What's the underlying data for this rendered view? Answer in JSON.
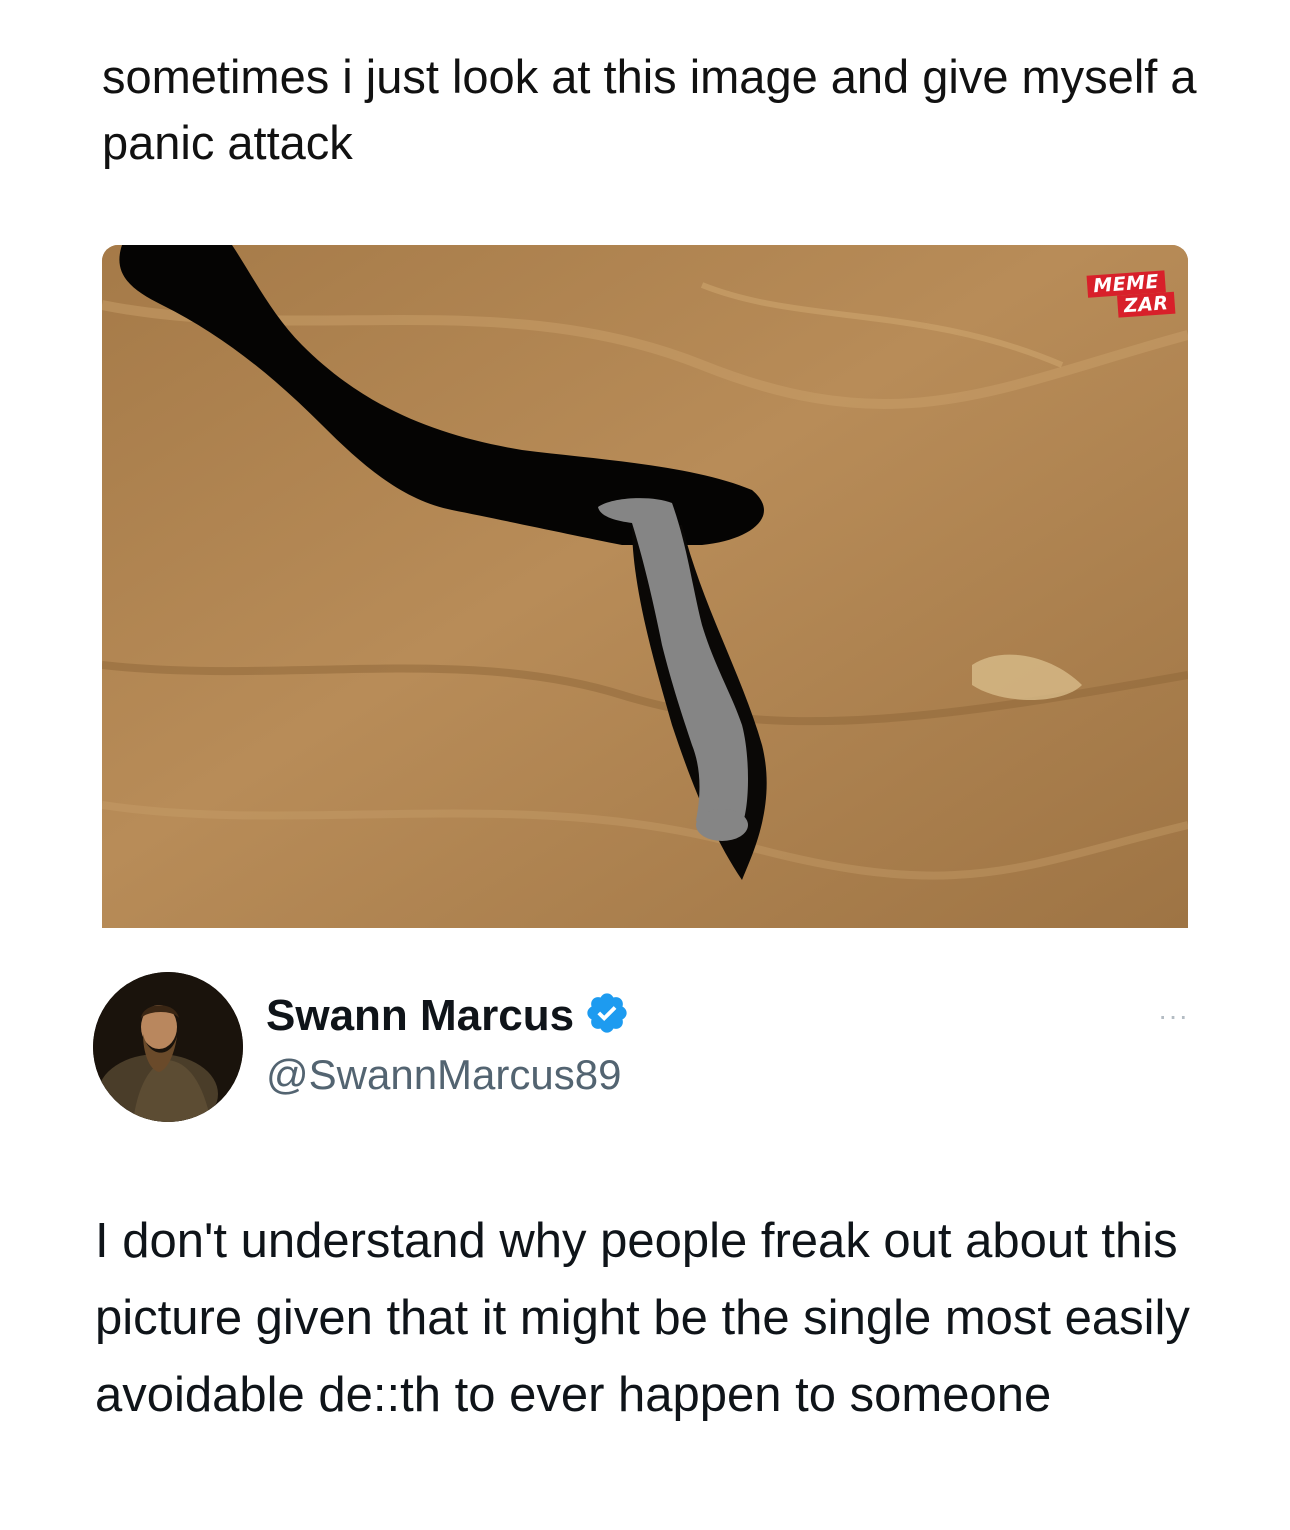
{
  "post": {
    "caption": "sometimes i just look at this image and give myself a panic attack"
  },
  "media": {
    "alt_subject": "crevice-with-silhouette",
    "watermark": {
      "line1": "MEME",
      "line2": "ZAR"
    }
  },
  "tweet": {
    "author_name": "Swann Marcus",
    "handle": "@SwannMarcus89",
    "verified": true,
    "more_label": "···",
    "text": "I don't understand why people freak out about this picture given that it might be the single most easily avoidable de::th to ever happen to someone"
  },
  "colors": {
    "verified_blue": "#1d9bf0",
    "handle_gray": "#536471",
    "rock": "#b08450"
  },
  "icons": {
    "verified": "verified-badge-icon",
    "more": "more-options-icon"
  }
}
